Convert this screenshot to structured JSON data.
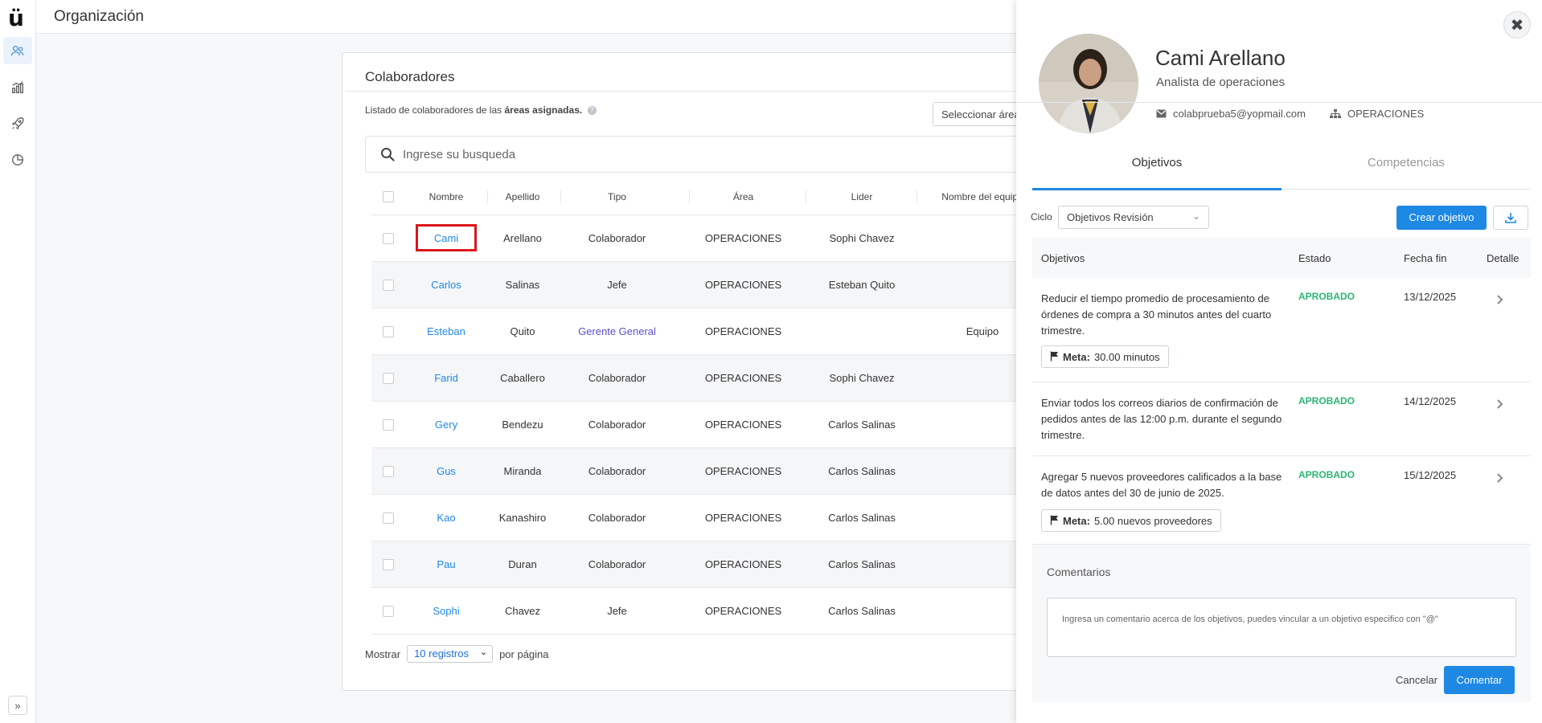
{
  "app": {
    "logo": "ü",
    "page_title": "Organización"
  },
  "sidebar": {
    "items": [
      {
        "icon": "users-icon",
        "active": true
      },
      {
        "icon": "chart-icon",
        "active": false
      },
      {
        "icon": "rocket-icon",
        "active": false
      },
      {
        "icon": "pie-chart-icon",
        "active": false
      }
    ],
    "expand_label": "»"
  },
  "colaboradores": {
    "title": "Colaboradores",
    "subtitle_prefix": "Listado de colaboradores de las",
    "subtitle_bold": "áreas asignadas.",
    "area_select": "Seleccionar área",
    "search_placeholder": "Ingrese su busqueda",
    "columns": [
      "Nombre",
      "Apellido",
      "Tipo",
      "Área",
      "Lider",
      "Nombre del equipo"
    ],
    "rows": [
      {
        "nombre": "Cami",
        "apellido": "Arellano",
        "tipo": "Colaborador",
        "area": "OPERACIONES",
        "lider": "Sophi Chavez",
        "equipo": ""
      },
      {
        "nombre": "Carlos",
        "apellido": "Salinas",
        "tipo": "Jefe",
        "area": "OPERACIONES",
        "lider": "Esteban Quito",
        "equipo": ""
      },
      {
        "nombre": "Esteban",
        "apellido": "Quito",
        "tipo": "Gerente General",
        "area": "OPERACIONES",
        "lider": "",
        "equipo": "Equipo"
      },
      {
        "nombre": "Farid",
        "apellido": "Caballero",
        "tipo": "Colaborador",
        "area": "OPERACIONES",
        "lider": "Sophi Chavez",
        "equipo": ""
      },
      {
        "nombre": "Gery",
        "apellido": "Bendezu",
        "tipo": "Colaborador",
        "area": "OPERACIONES",
        "lider": "Carlos Salinas",
        "equipo": ""
      },
      {
        "nombre": "Gus",
        "apellido": "Miranda",
        "tipo": "Colaborador",
        "area": "OPERACIONES",
        "lider": "Carlos Salinas",
        "equipo": ""
      },
      {
        "nombre": "Kao",
        "apellido": "Kanashiro",
        "tipo": "Colaborador",
        "area": "OPERACIONES",
        "lider": "Carlos Salinas",
        "equipo": ""
      },
      {
        "nombre": "Pau",
        "apellido": "Duran",
        "tipo": "Colaborador",
        "area": "OPERACIONES",
        "lider": "Carlos Salinas",
        "equipo": ""
      },
      {
        "nombre": "Sophi",
        "apellido": "Chavez",
        "tipo": "Jefe",
        "area": "OPERACIONES",
        "lider": "Carlos Salinas",
        "equipo": ""
      }
    ],
    "pager": {
      "show_label": "Mostrar",
      "page_size": "10 registros",
      "per_page_label": "por página"
    }
  },
  "profile": {
    "name": "Cami Arellano",
    "role": "Analista de operaciones",
    "email": "colabprueba5@yopmail.com",
    "area": "OPERACIONES",
    "tabs": [
      "Objetivos",
      "Competencias"
    ],
    "ciclo_label": "Ciclo",
    "ciclo_value": "Objetivos Revisión",
    "create_button": "Crear objetivo",
    "objectives_columns": [
      "Objetivos",
      "Estado",
      "Fecha fin",
      "Detalle"
    ],
    "objectives": [
      {
        "text": "Reducir el tiempo promedio de procesamiento de órdenes de compra a 30 minutos antes del cuarto trimestre.",
        "estado": "APROBADO",
        "fecha": "13/12/2025",
        "meta_label": "Meta:",
        "meta_value": "30.00 minutos"
      },
      {
        "text": "Enviar todos los correos diarios de confirmación de pedidos antes de las 12:00 p.m. durante el segundo trimestre.",
        "estado": "APROBADO",
        "fecha": "14/12/2025",
        "meta_label": "",
        "meta_value": ""
      },
      {
        "text": "Agregar 5 nuevos proveedores calificados a la base de datos antes del 30 de junio de 2025.",
        "estado": "APROBADO",
        "fecha": "15/12/2025",
        "meta_label": "Meta:",
        "meta_value": "5.00 nuevos proveedores"
      }
    ],
    "comments": {
      "title": "Comentarios",
      "placeholder": "Ingresa un comentario acerca de los objetivos, puedes vincular a un objetivo especifico con \"@\"",
      "cancel": "Cancelar",
      "submit": "Comentar"
    },
    "colors": {
      "accent": "#1e88e5",
      "approved": "#2bb673",
      "highlight": "#d9161c"
    }
  }
}
